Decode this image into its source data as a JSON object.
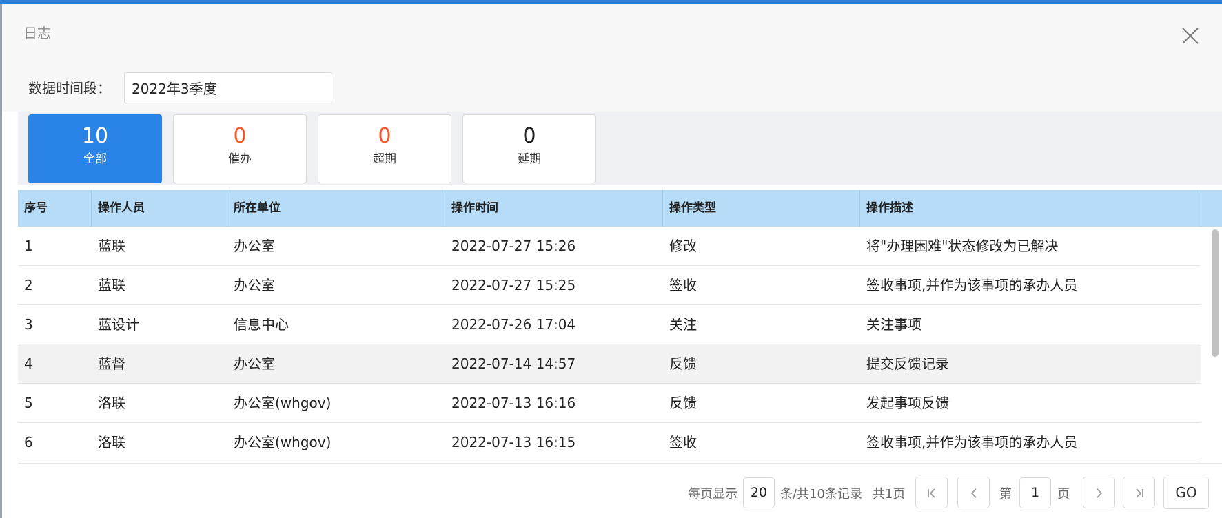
{
  "dialog": {
    "title": "日志"
  },
  "filter": {
    "label": "数据时间段：",
    "value": "2022年3季度"
  },
  "stats": [
    {
      "count": "10",
      "label": "全部"
    },
    {
      "count": "0",
      "label": "催办"
    },
    {
      "count": "0",
      "label": "超期"
    },
    {
      "count": "0",
      "label": "延期"
    }
  ],
  "table": {
    "columns": [
      "序号",
      "操作人员",
      "所在单位",
      "操作时间",
      "操作类型",
      "操作描述"
    ],
    "rows": [
      {
        "no": "1",
        "person": "蓝联",
        "unit": "办公室",
        "time": "2022-07-27 15:26",
        "type": "修改",
        "desc": "将\"办理困难\"状态修改为已解决"
      },
      {
        "no": "2",
        "person": "蓝联",
        "unit": "办公室",
        "time": "2022-07-27 15:25",
        "type": "签收",
        "desc": "签收事项,并作为该事项的承办人员"
      },
      {
        "no": "3",
        "person": "蓝设计",
        "unit": "信息中心",
        "time": "2022-07-26 17:04",
        "type": "关注",
        "desc": "关注事项"
      },
      {
        "no": "4",
        "person": "蓝督",
        "unit": "办公室",
        "time": "2022-07-14 14:57",
        "type": "反馈",
        "desc": "提交反馈记录"
      },
      {
        "no": "5",
        "person": "洛联",
        "unit": "办公室(whgov)",
        "time": "2022-07-13 16:16",
        "type": "反馈",
        "desc": "发起事项反馈"
      },
      {
        "no": "6",
        "person": "洛联",
        "unit": "办公室(whgov)",
        "time": "2022-07-13 16:15",
        "type": "签收",
        "desc": "签收事项,并作为该事项的承办人员"
      }
    ]
  },
  "pager": {
    "per_page_label": "每页显示",
    "per_page_value": "20",
    "records_label": "条/共10条记录",
    "pages_label": "共1页",
    "page_prefix": "第",
    "page_value": "1",
    "page_suffix": "页",
    "go_label": "GO"
  }
}
